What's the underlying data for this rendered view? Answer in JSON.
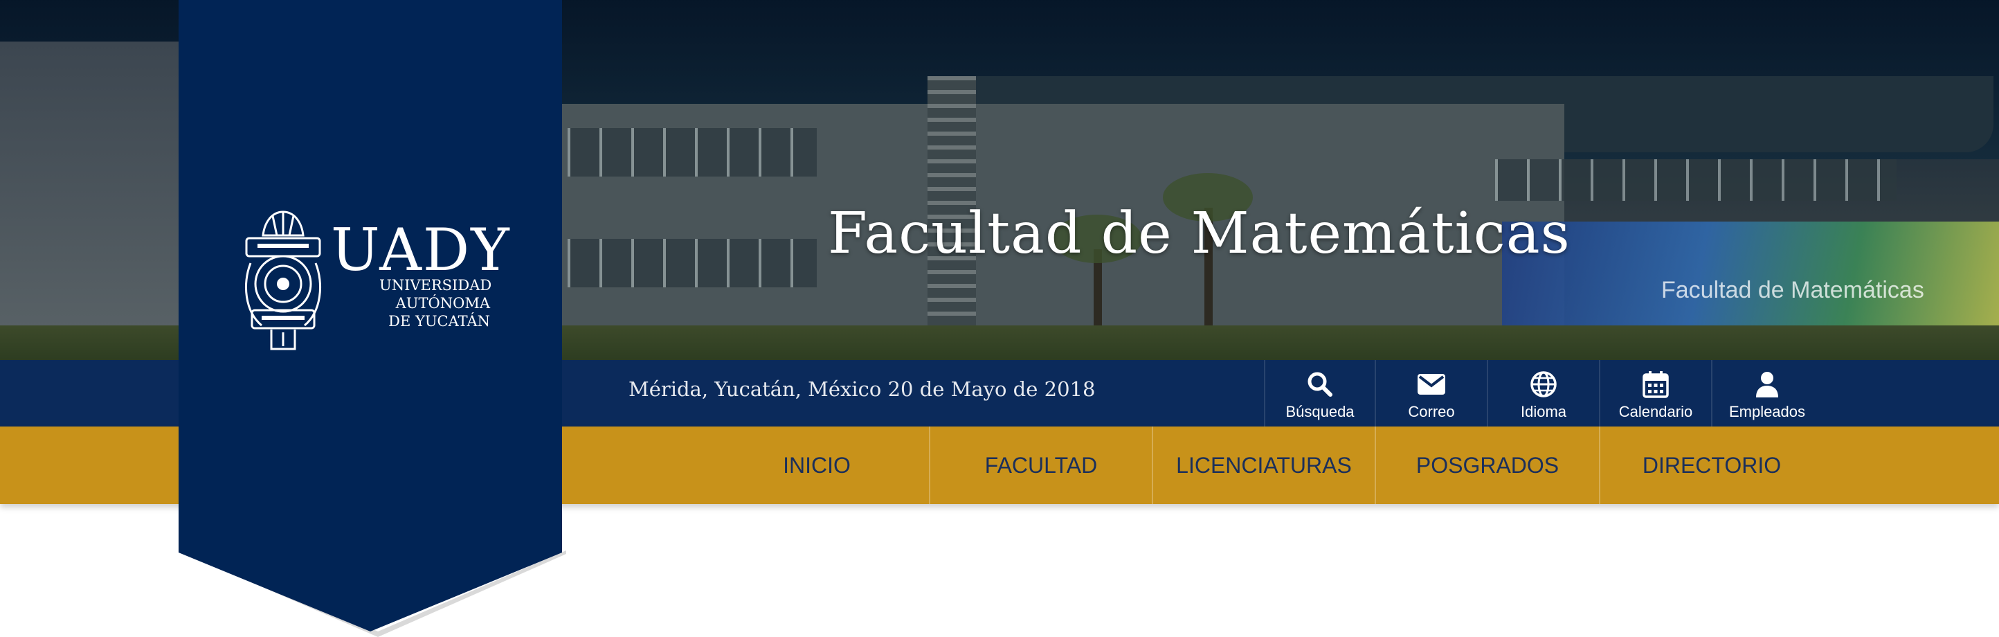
{
  "hero": {
    "title": "Facultad de Matemáticas",
    "mural_text": "Facultad de Matemáticas"
  },
  "logo": {
    "name": "UADY",
    "line1": "UNIVERSIDAD",
    "line2": "AUTÓNOMA",
    "line3": "DE YUCATÁN"
  },
  "topbar": {
    "date": "Mérida, Yucatán, México 20 de Mayo de 2018",
    "utilities": [
      {
        "label": "Búsqueda",
        "icon": "search-icon"
      },
      {
        "label": "Correo",
        "icon": "mail-icon"
      },
      {
        "label": "Idioma",
        "icon": "globe-icon"
      },
      {
        "label": "Calendario",
        "icon": "calendar-icon"
      },
      {
        "label": "Empleados",
        "icon": "user-icon"
      }
    ]
  },
  "nav": {
    "items": [
      {
        "label": "INICIO"
      },
      {
        "label": "FACULTAD"
      },
      {
        "label": "LICENCIATURAS"
      },
      {
        "label": "POSGRADOS"
      },
      {
        "label": "DIRECTORIO"
      }
    ]
  },
  "colors": {
    "blue": "#0b2a5b",
    "banner_blue": "#012455",
    "gold": "#c8921a",
    "nav_text": "#1b2f5a"
  }
}
